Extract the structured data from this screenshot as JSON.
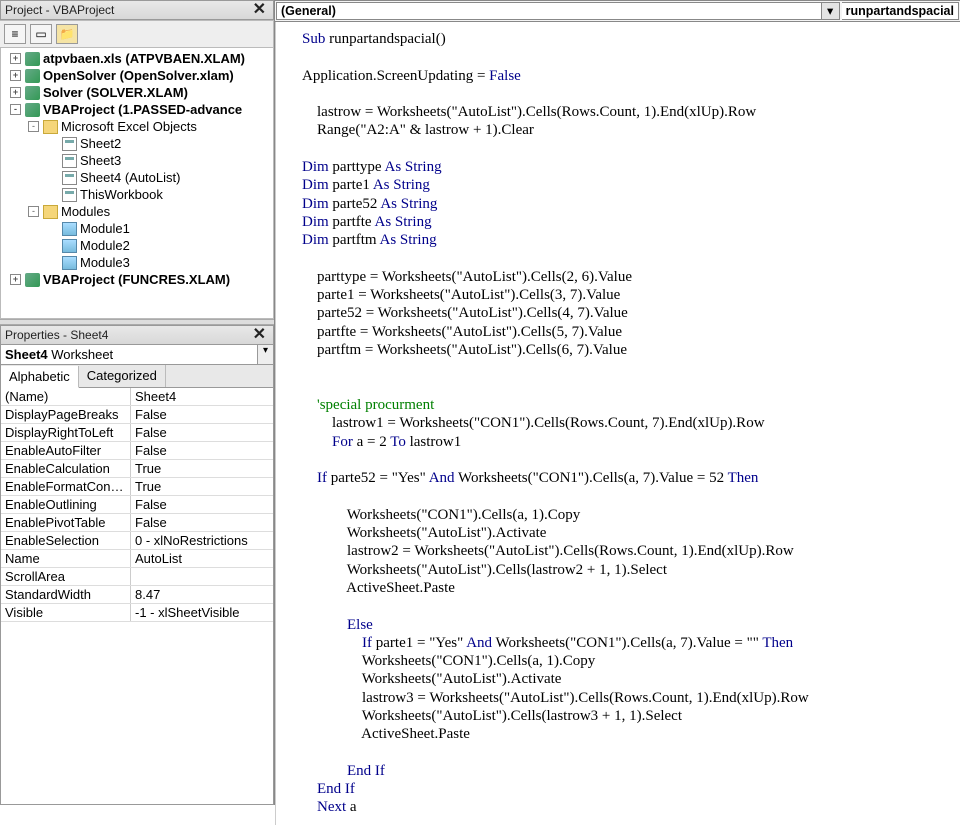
{
  "project_panel": {
    "title": "Project - VBAProject",
    "tree": [
      {
        "indent": 0,
        "exp": "+",
        "icon": "icon-vba",
        "bold": true,
        "label": "atpvbaen.xls (ATPVBAEN.XLAM)"
      },
      {
        "indent": 0,
        "exp": "+",
        "icon": "icon-vba",
        "bold": true,
        "label": "OpenSolver (OpenSolver.xlam)"
      },
      {
        "indent": 0,
        "exp": "+",
        "icon": "icon-vba",
        "bold": true,
        "label": "Solver (SOLVER.XLAM)"
      },
      {
        "indent": 0,
        "exp": "-",
        "icon": "icon-vba",
        "bold": true,
        "label": "VBAProject (1.PASSED-advance"
      },
      {
        "indent": 1,
        "exp": "-",
        "icon": "icon-folder-open",
        "bold": false,
        "label": "Microsoft Excel Objects"
      },
      {
        "indent": 2,
        "exp": "",
        "icon": "icon-sheet",
        "bold": false,
        "label": "Sheet2"
      },
      {
        "indent": 2,
        "exp": "",
        "icon": "icon-sheet",
        "bold": false,
        "label": "Sheet3"
      },
      {
        "indent": 2,
        "exp": "",
        "icon": "icon-sheet",
        "bold": false,
        "label": "Sheet4 (AutoList)"
      },
      {
        "indent": 2,
        "exp": "",
        "icon": "icon-sheet",
        "bold": false,
        "label": "ThisWorkbook"
      },
      {
        "indent": 1,
        "exp": "-",
        "icon": "icon-folder-open",
        "bold": false,
        "label": "Modules"
      },
      {
        "indent": 2,
        "exp": "",
        "icon": "icon-mod",
        "bold": false,
        "label": "Module1"
      },
      {
        "indent": 2,
        "exp": "",
        "icon": "icon-mod",
        "bold": false,
        "label": "Module2"
      },
      {
        "indent": 2,
        "exp": "",
        "icon": "icon-mod",
        "bold": false,
        "label": "Module3"
      },
      {
        "indent": 0,
        "exp": "+",
        "icon": "icon-vba",
        "bold": true,
        "label": "VBAProject (FUNCRES.XLAM)"
      }
    ]
  },
  "properties_panel": {
    "title": "Properties - Sheet4",
    "selected_name": "Sheet4",
    "selected_type": "Worksheet",
    "tabs": {
      "alphabetic": "Alphabetic",
      "categorized": "Categorized"
    },
    "rows": [
      {
        "k": "(Name)",
        "v": "Sheet4"
      },
      {
        "k": "DisplayPageBreaks",
        "v": "False"
      },
      {
        "k": "DisplayRightToLeft",
        "v": "False"
      },
      {
        "k": "EnableAutoFilter",
        "v": "False"
      },
      {
        "k": "EnableCalculation",
        "v": "True"
      },
      {
        "k": "EnableFormatConditio",
        "v": "True"
      },
      {
        "k": "EnableOutlining",
        "v": "False"
      },
      {
        "k": "EnablePivotTable",
        "v": "False"
      },
      {
        "k": "EnableSelection",
        "v": "0 - xlNoRestrictions"
      },
      {
        "k": "Name",
        "v": "AutoList"
      },
      {
        "k": "ScrollArea",
        "v": ""
      },
      {
        "k": "StandardWidth",
        "v": "8.47"
      },
      {
        "k": "Visible",
        "v": "-1 - xlSheetVisible"
      }
    ]
  },
  "code_header": {
    "left": "(General)",
    "right": "runpartandspacial"
  },
  "code": {
    "l1a": "Sub",
    "l1b": " runpartandspacial()",
    "l2a": "Application.ScreenUpdating = ",
    "l2b": "False",
    "l3": "    lastrow = Worksheets(\"AutoList\").Cells(Rows.Count, 1).End(xlUp).Row",
    "l4": "    Range(\"A2:A\" & lastrow + 1).Clear",
    "d1a": "Dim",
    "d1b": " parttype ",
    "d1c": "As String",
    "d2a": "Dim",
    "d2b": " parte1 ",
    "d2c": "As String",
    "d3a": "Dim",
    "d3b": " parte52 ",
    "d3c": "As String",
    "d4a": "Dim",
    "d4b": " partfte ",
    "d4c": "As String",
    "d5a": "Dim",
    "d5b": " partftm ",
    "d5c": "As String",
    "a1": "    parttype = Worksheets(\"AutoList\").Cells(2, 6).Value",
    "a2": "    parte1 = Worksheets(\"AutoList\").Cells(3, 7).Value",
    "a3": "    parte52 = Worksheets(\"AutoList\").Cells(4, 7).Value",
    "a4": "    partfte = Worksheets(\"AutoList\").Cells(5, 7).Value",
    "a5": "    partftm = Worksheets(\"AutoList\").Cells(6, 7).Value",
    "c1": "    'special procurment",
    "b1": "        lastrow1 = Worksheets(\"CON1\").Cells(Rows.Count, 7).End(xlUp).Row",
    "b2a": "        ",
    "b2b": "For",
    "b2c": " a = 2 ",
    "b2d": "To",
    "b2e": " lastrow1",
    "if1a": "    ",
    "if1b": "If",
    "if1c": " parte52 = \"Yes\" ",
    "if1d": "And",
    "if1e": " Worksheets(\"CON1\").Cells(a, 7).Value = 52 ",
    "if1f": "Then",
    "p1": "            Worksheets(\"CON1\").Cells(a, 1).Copy",
    "p2": "            Worksheets(\"AutoList\").Activate",
    "p3": "            lastrow2 = Worksheets(\"AutoList\").Cells(Rows.Count, 1).End(xlUp).Row",
    "p4": "            Worksheets(\"AutoList\").Cells(lastrow2 + 1, 1).Select",
    "p5": "            ActiveSheet.Paste",
    "el": "            Else",
    "if2a": "                ",
    "if2b": "If",
    "if2c": " parte1 = \"Yes\" ",
    "if2d": "And",
    "if2e": " Worksheets(\"CON1\").Cells(a, 7).Value = \"\" ",
    "if2f": "Then",
    "q1": "                Worksheets(\"CON1\").Cells(a, 1).Copy",
    "q2": "                Worksheets(\"AutoList\").Activate",
    "q3": "                lastrow3 = Worksheets(\"AutoList\").Cells(Rows.Count, 1).End(xlUp).Row",
    "q4": "                Worksheets(\"AutoList\").Cells(lastrow3 + 1, 1).Select",
    "q5": "                ActiveSheet.Paste",
    "ei1": "            End If",
    "ei2": "    End If",
    "nx": "    Next",
    "nxb": " a"
  }
}
